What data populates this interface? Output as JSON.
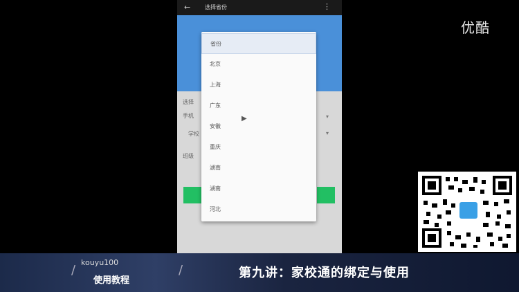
{
  "phone": {
    "status": {
      "back_icon": "←",
      "title": "选择省份",
      "more_icon": "⋮"
    },
    "form": {
      "labels": [
        "选择",
        "手机",
        "学校",
        "班级"
      ],
      "arrows": [
        "▾",
        "▾"
      ]
    }
  },
  "dropdown": {
    "items": [
      "省份",
      "北京",
      "上海",
      "广东",
      "安徽",
      "重庆",
      "湖南",
      "湖南",
      "河北"
    ],
    "selected_index": 0
  },
  "watermark": {
    "logo": "优酷"
  },
  "banner": {
    "channel": "kouyu100",
    "subtitle": "使用教程",
    "lecture": "第九讲：家校通的绑定与使用"
  },
  "colors": {
    "header_blue": "#4a90d9",
    "button_green": "#22bf63"
  }
}
